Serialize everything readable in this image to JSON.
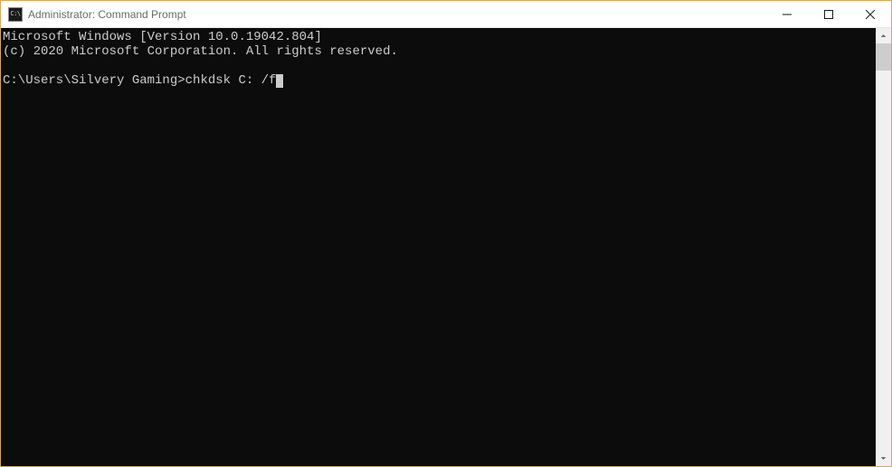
{
  "window": {
    "title": "Administrator: Command Prompt",
    "icon_label": "C:\\"
  },
  "console": {
    "line1": "Microsoft Windows [Version 10.0.19042.804]",
    "line2": "(c) 2020 Microsoft Corporation. All rights reserved.",
    "prompt": "C:\\Users\\Silvery Gaming>",
    "command": "chkdsk C: /f"
  }
}
